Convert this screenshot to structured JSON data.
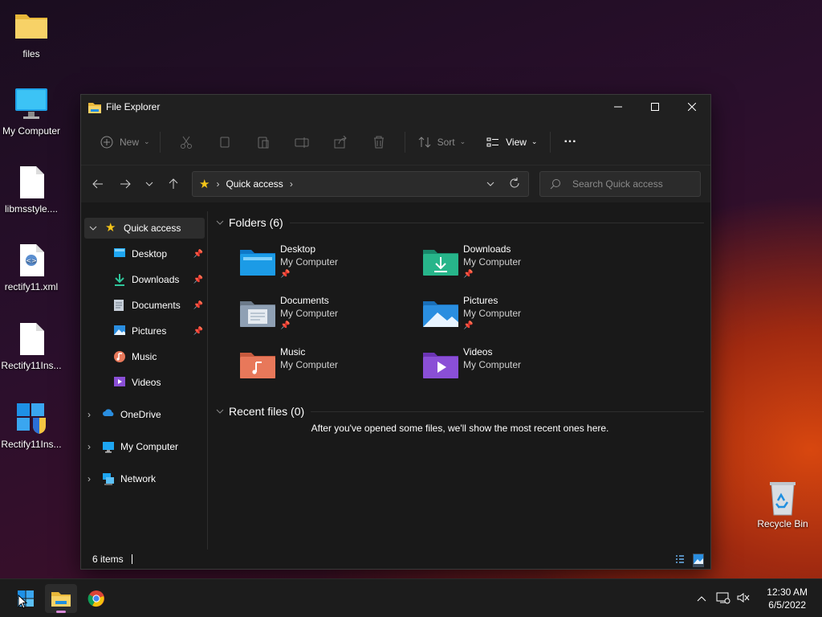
{
  "desktop": {
    "icons": [
      {
        "label": "files",
        "icon": "folder-icon"
      },
      {
        "label": "My Computer",
        "icon": "monitor-icon"
      },
      {
        "label": "libmsstyle....",
        "icon": "blank-file-icon"
      },
      {
        "label": "rectify11.xml",
        "icon": "xml-file-icon"
      },
      {
        "label": "Rectify11Ins...",
        "icon": "blank-file-icon"
      },
      {
        "label": "Rectify11Ins...",
        "icon": "installer-icon"
      }
    ],
    "recycle_bin": {
      "label": "Recycle Bin"
    }
  },
  "window": {
    "title": "File Explorer",
    "toolbar": {
      "new_label": "New",
      "sort_label": "Sort",
      "view_label": "View",
      "more_label": "···"
    },
    "address": {
      "location": "Quick access"
    },
    "search": {
      "placeholder": "Search Quick access"
    },
    "sidebar": {
      "quick_access": "Quick access",
      "pinned": [
        {
          "label": "Desktop",
          "pinned": true
        },
        {
          "label": "Downloads",
          "pinned": true
        },
        {
          "label": "Documents",
          "pinned": true
        },
        {
          "label": "Pictures",
          "pinned": true
        },
        {
          "label": "Music",
          "pinned": false
        },
        {
          "label": "Videos",
          "pinned": false
        }
      ],
      "roots": [
        "OneDrive",
        "My Computer",
        "Network"
      ]
    },
    "folders_header": "Folders (6)",
    "folders": [
      {
        "name": "Desktop",
        "location": "My Computer",
        "pinned": true,
        "color": "#1c9be6"
      },
      {
        "name": "Downloads",
        "location": "My Computer",
        "pinned": true,
        "color": "#27b58a"
      },
      {
        "name": "Documents",
        "location": "My Computer",
        "pinned": true,
        "color": "#8fa0b4"
      },
      {
        "name": "Pictures",
        "location": "My Computer",
        "pinned": true,
        "color": "#2a8ee0"
      },
      {
        "name": "Music",
        "location": "My Computer",
        "pinned": false,
        "color": "#e8785a"
      },
      {
        "name": "Videos",
        "location": "My Computer",
        "pinned": false,
        "color": "#8a4fd6"
      }
    ],
    "recent_header": "Recent files (0)",
    "recent_empty": "After you've opened some files, we'll show the most recent ones here.",
    "status": {
      "items": "6 items"
    }
  },
  "taskbar": {
    "time": "12:30 AM",
    "date": "6/5/2022"
  }
}
